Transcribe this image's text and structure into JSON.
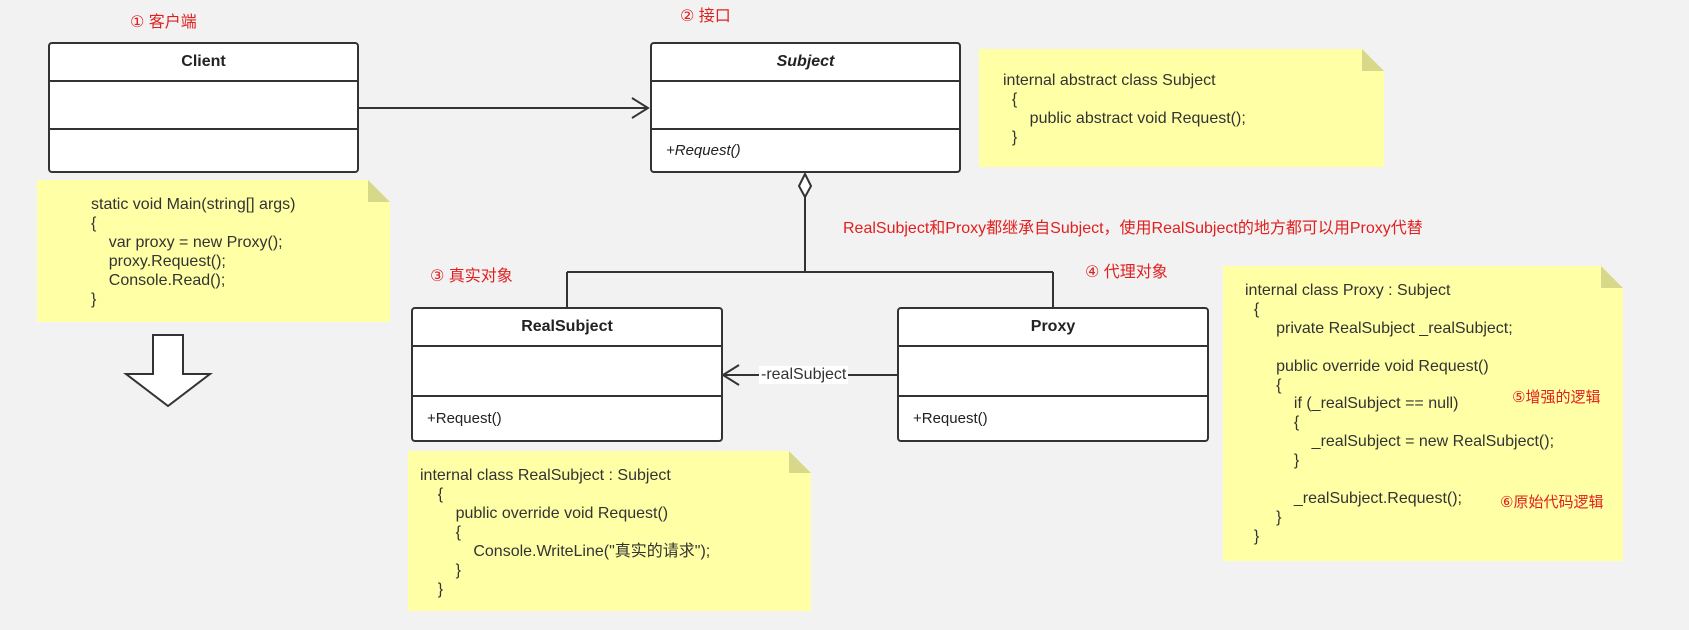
{
  "labels": {
    "client_tag": "① 客户端",
    "interface_tag": "② 接口",
    "real_tag": "③ 真实对象",
    "proxy_tag": "④ 代理对象",
    "inherit_note": "RealSubject和Proxy都继承自Subject，使用RealSubject的地方都可以用Proxy代替",
    "enhance_tag": "⑤增强的逻辑",
    "original_tag": "⑥原始代码逻辑"
  },
  "classes": {
    "client": {
      "name": "Client",
      "op": ""
    },
    "subject": {
      "name": "Subject",
      "op": "+Request()"
    },
    "real_subject": {
      "name": "RealSubject",
      "op": "+Request()"
    },
    "proxy": {
      "name": "Proxy",
      "op": "+Request()"
    }
  },
  "association_label": "-realSubject",
  "notes": {
    "client_code": "static void Main(string[] args)\n{\n    var proxy = new Proxy();\n    proxy.Request();\n    Console.Read();\n}",
    "subject_code": "internal abstract class Subject\n  {\n      public abstract void Request();\n  }",
    "real_code": "internal class RealSubject : Subject\n    {\n        public override void Request()\n        {\n            Console.WriteLine(\"真实的请求\");\n        }\n    }",
    "proxy_code": "internal class Proxy : Subject\n  {\n       private RealSubject _realSubject;\n\n       public override void Request()\n       {\n           if (_realSubject == null)\n           {\n               _realSubject = new RealSubject();\n           }\n\n           _realSubject.Request();\n       }\n  }"
  }
}
